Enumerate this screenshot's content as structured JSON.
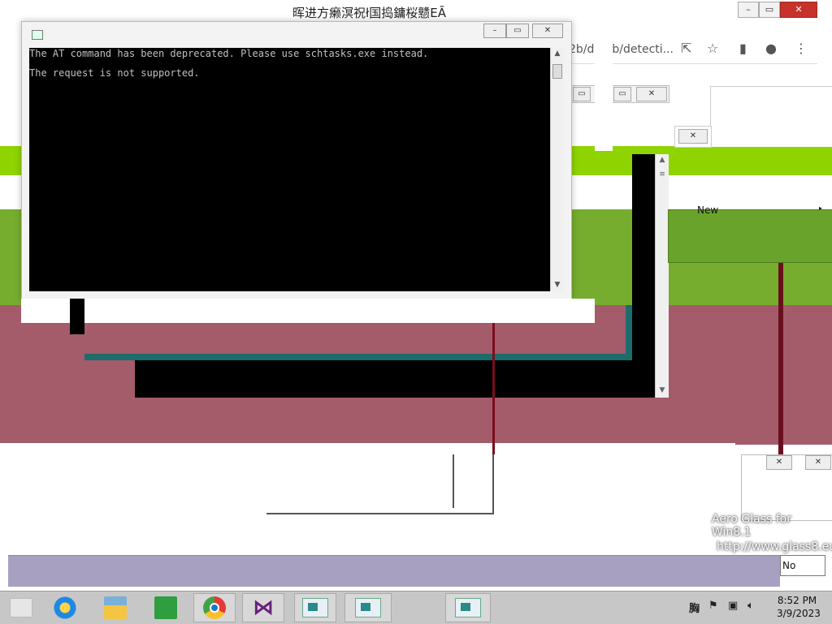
{
  "top_window": {
    "title": "晖进方癞溟祝ł国捣鏞桜戆EĀ",
    "controls": [
      "–",
      "▭",
      "✕"
    ]
  },
  "browser": {
    "url_fragment": "2b/de  2b/detecti...",
    "icons": [
      "share-icon",
      "star-icon",
      "sidebar-icon",
      "profile-icon",
      "menu-icon"
    ]
  },
  "console": {
    "lines": [
      "The AT command has been deprecated. Please use schtasks.exe instead.",
      "The request is not supported."
    ],
    "controls": [
      "–",
      "▭",
      "✕"
    ]
  },
  "context_menu": {
    "item_new": "New",
    "submenu_arrow": "▸"
  },
  "watermark": {
    "line1": "Aero Glass for Win8.1",
    "line2": "http://www.glass8.eu"
  },
  "dialog": {
    "no_label": "No"
  },
  "taskbar": {
    "apps": [
      "Internet Explorer",
      "File Explorer",
      "Store",
      "Google Chrome",
      "Visual Studio",
      "Command Prompt",
      "Command Prompt",
      "Command Prompt"
    ],
    "tray_text": "胸",
    "time": "8:52 PM",
    "date": "3/9/2023"
  }
}
